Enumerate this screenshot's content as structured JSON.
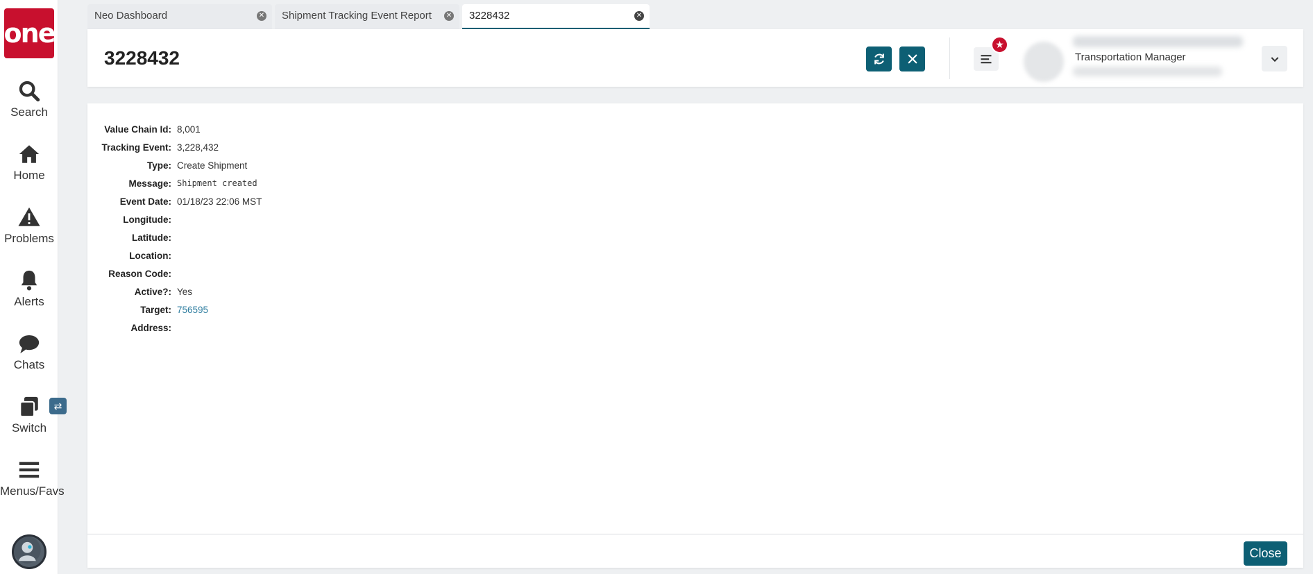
{
  "nav": {
    "logo_text": "one",
    "items": [
      {
        "label": "Search",
        "icon": "search-icon"
      },
      {
        "label": "Home",
        "icon": "home-icon"
      },
      {
        "label": "Problems",
        "icon": "warning-icon"
      },
      {
        "label": "Alerts",
        "icon": "bell-icon"
      },
      {
        "label": "Chats",
        "icon": "chat-icon"
      },
      {
        "label": "Switch",
        "icon": "switch-icon"
      },
      {
        "label": "Menus/Favs",
        "icon": "menu-icon"
      }
    ]
  },
  "tabs": [
    {
      "label": "Neo Dashboard",
      "active": false
    },
    {
      "label": "Shipment Tracking Event Report",
      "active": false
    },
    {
      "label": "3228432",
      "active": true
    }
  ],
  "header": {
    "title": "3228432",
    "user_role": "Transportation Manager"
  },
  "details": {
    "fields": [
      {
        "label": "Value Chain Id:",
        "value": "8,001"
      },
      {
        "label": "Tracking Event:",
        "value": "3,228,432"
      },
      {
        "label": "Type:",
        "value": "Create Shipment"
      },
      {
        "label": "Message:",
        "value": "Shipment created"
      },
      {
        "label": "Event Date:",
        "value": "01/18/23 22:06 MST"
      },
      {
        "label": "Longitude:",
        "value": ""
      },
      {
        "label": "Latitude:",
        "value": ""
      },
      {
        "label": "Location:",
        "value": ""
      },
      {
        "label": "Reason Code:",
        "value": ""
      },
      {
        "label": "Active?:",
        "value": "Yes"
      },
      {
        "label": "Target:",
        "value": "756595"
      },
      {
        "label": "Address:",
        "value": ""
      }
    ]
  },
  "footer": {
    "close_label": "Close"
  },
  "colors": {
    "accent": "#0d5f74",
    "brand_red": "#c8102e",
    "link": "#2f7ea0"
  }
}
